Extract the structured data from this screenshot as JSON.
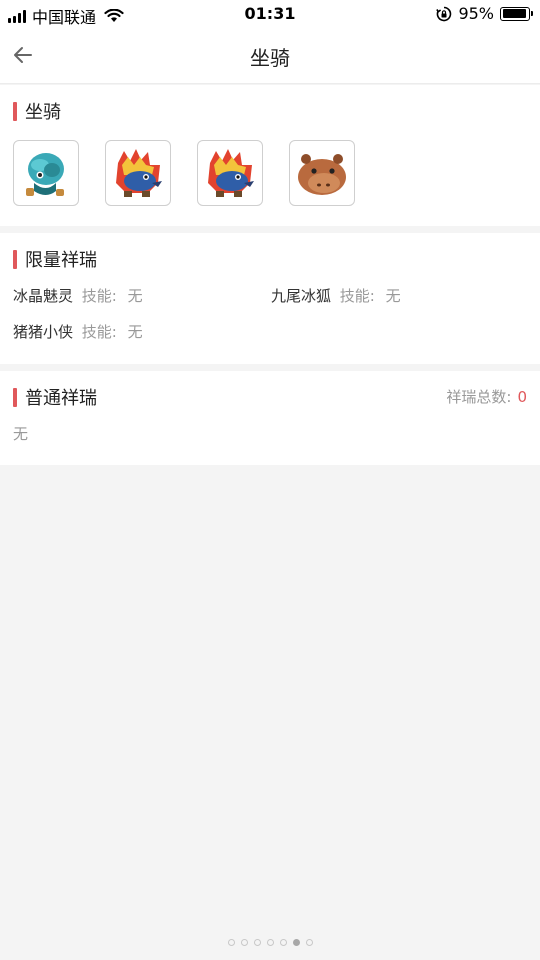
{
  "status_bar": {
    "carrier": "中国联通",
    "time": "01:31",
    "battery_percent": "95%",
    "battery_level": 0.95,
    "icons": [
      "signal-icon",
      "wifi-icon",
      "rotation-lock-icon",
      "battery-icon"
    ]
  },
  "nav": {
    "title": "坐骑",
    "back_icon": "back-arrow-icon"
  },
  "mounts_section": {
    "title": "坐骑",
    "items": [
      {
        "icon": "teal-creature-mount"
      },
      {
        "icon": "fire-dragon-mount"
      },
      {
        "icon": "fire-dragon-mount"
      },
      {
        "icon": "capybara-mount"
      }
    ]
  },
  "limited_section": {
    "title": "限量祥瑞",
    "items": [
      {
        "name": "冰晶魅灵",
        "skill_label": "技能:",
        "skill_value": "无"
      },
      {
        "name": "九尾冰狐",
        "skill_label": "技能:",
        "skill_value": "无"
      },
      {
        "name": "猪猪小侠",
        "skill_label": "技能:",
        "skill_value": "无"
      }
    ]
  },
  "normal_section": {
    "title": "普通祥瑞",
    "total_label": "祥瑞总数:",
    "total_value": "0",
    "empty_text": "无"
  },
  "pagination": {
    "count": 7,
    "active_index": 5
  },
  "colors": {
    "accent": "#e0585b",
    "background": "#f4f4f4",
    "card": "#ffffff"
  }
}
